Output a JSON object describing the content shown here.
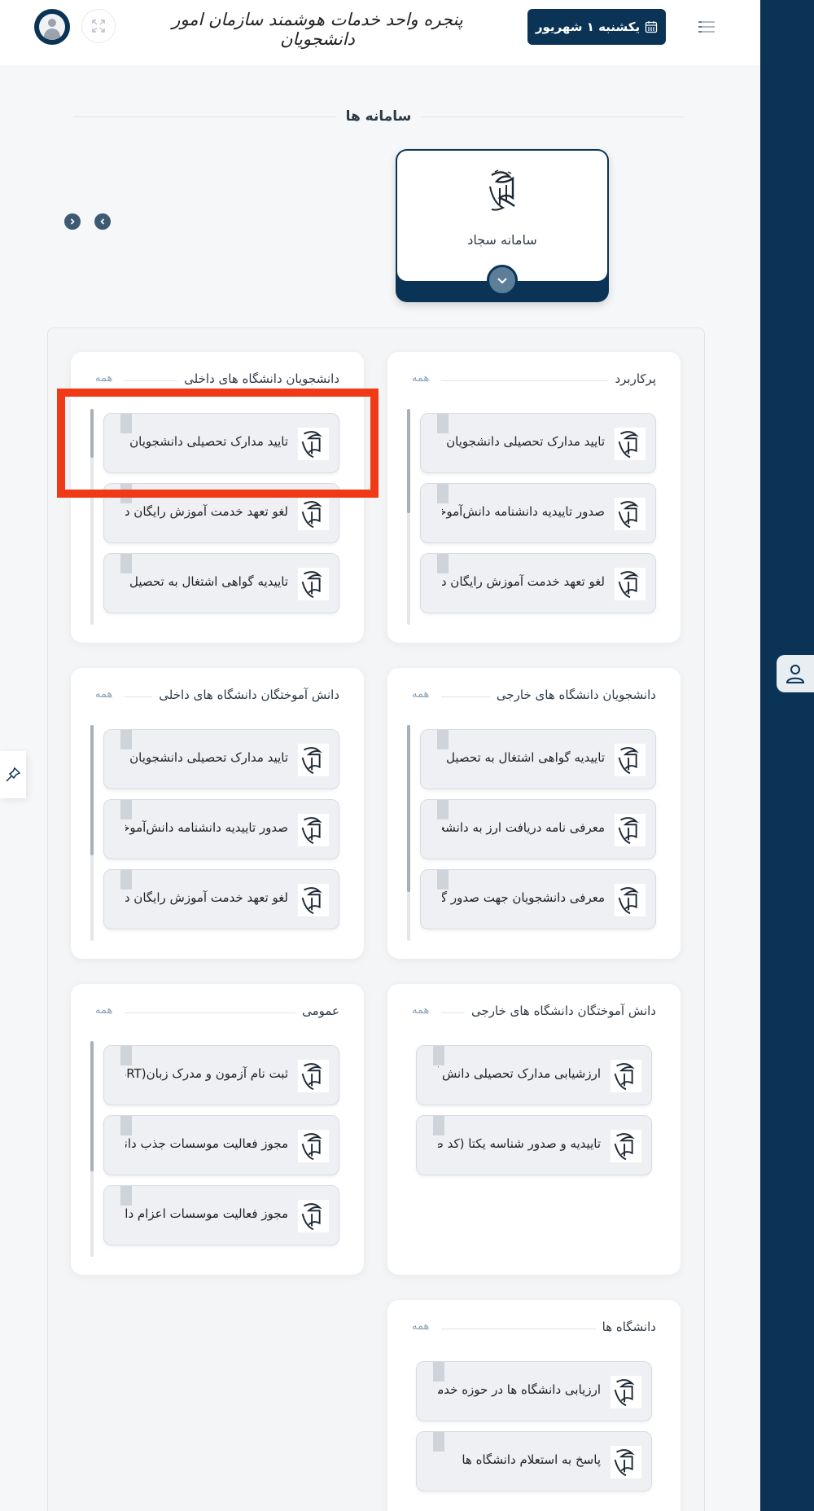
{
  "header": {
    "title": "پنجره واحد خدمات هوشمند سازمان امور دانشجویان",
    "date_label": "یکشنبه ۱ شهریور"
  },
  "systems": {
    "heading": "سامانه ها",
    "featured_label": "سامانه سجاد"
  },
  "panels": [
    {
      "title": "پرکاربرد",
      "all": "همه",
      "items": [
        "تایید مدارک تحصیلی دانشجویان و",
        "صدور تاییدیه دانشنامه دانش‌آموخت",
        "لغو تعهد خدمت آموزش رایگان دان"
      ]
    },
    {
      "title": "دانشجویان دانشگاه های داخلی",
      "all": "همه",
      "items": [
        "تایید مدارک تحصیلی دانشجویان و",
        "لغو تعهد خدمت آموزش رایگان دان",
        "تاییدیه گواهی اشتغال به تحصیل د"
      ]
    },
    {
      "title": "دانشجویان دانشگاه های خارجی",
      "all": "همه",
      "items": [
        "تاییدیه گواهی اشتغال به تحصیل د",
        "معرفی نامه دریافت ارز به دانشجویا",
        "معرفی دانشجویان جهت صدور گواه"
      ]
    },
    {
      "title": "دانش آموختگان دانشگاه های داخلی",
      "all": "همه",
      "items": [
        "تایید مدارک تحصیلی دانشجویان و",
        "صدور تاییدیه دانشنامه دانش‌آموخت",
        "لغو تعهد خدمت آموزش رایگان دان"
      ]
    },
    {
      "title": "دانش آموختگان دانشگاه های خارجی",
      "all": "همه",
      "items": [
        "ارزشیابی مدارک تحصیلی دانش آمو",
        "تاییدیه و صدور شناسه یکتا (کد صد"
      ]
    },
    {
      "title": "عمومی",
      "all": "همه",
      "items": [
        "ثبت نام آزمون و مدرک زبان(ISRT",
        "مجوز فعالیت موسسات جذب دانش",
        "مجوز فعالیت موسسات اعزام دانش"
      ]
    },
    {
      "title": "دانشگاه ها",
      "all": "همه",
      "items": [
        "ارزیابی دانشگاه ها در حوزه خدمات",
        "پاسخ به استعلام دانشگاه ها"
      ]
    }
  ]
}
